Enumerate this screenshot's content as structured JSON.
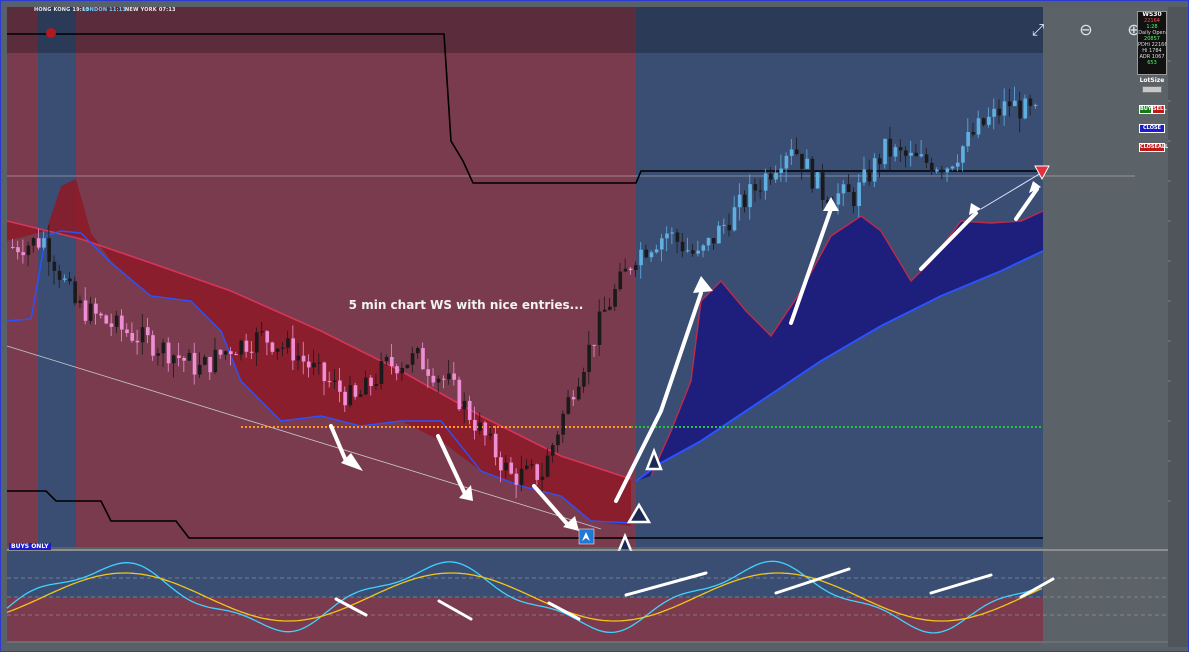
{
  "sessions": [
    {
      "label": "HONG KONG 19:13",
      "color": "#e0a020"
    },
    {
      "label": "LONDON 11:13",
      "color": "#6fc9ff"
    },
    {
      "label": "NEW YORK 07:13",
      "color": "#e8e8e8"
    }
  ],
  "toolbar": {
    "fullscreen_icon": "expand-icon",
    "zoom_out_icon": "zoom-out-icon",
    "zoom_in_icon": "zoom-in-icon"
  },
  "symbol_panel": {
    "symbol": "WS30",
    "lines": [
      "22164",
      "1:28",
      "Daily Open",
      "20857",
      "PDHi 22166",
      "Hi 1784",
      "ADR 1067",
      "653"
    ]
  },
  "trade_panel": {
    "lot_label": "LotSize",
    "buy": "BUY",
    "sell": "SELL",
    "close": "CLOSE",
    "closeall": "CLOSEALL"
  },
  "annotation": "5 min chart WS with nice entries...",
  "buys_only": "BUYS ONLY",
  "colors": {
    "bear_bg": "#7a3b4f",
    "bull_bg": "#3a4e74",
    "bull_candle": "#5fb0e0",
    "bear_candle": "#ee8fd6",
    "cloud_bear": "#8c1c28",
    "cloud_bull": "#1c1c7c",
    "gray_bg": "#5b6268"
  },
  "chart_data": {
    "type": "line",
    "title": "",
    "xlabel": "",
    "ylabel": "",
    "series": [
      {
        "values": [
          21720,
          21740,
          21560,
          21510,
          21470,
          21430,
          21380,
          21440,
          21470,
          21430,
          21350,
          21290,
          21390,
          21410,
          21340,
          21210,
          21080,
          21090,
          21330,
          21540,
          21700,
          21760,
          21690,
          21800,
          21900,
          22010,
          21870,
          21860,
          21990,
          21960,
          21950,
          22050,
          22120,
          22080
        ]
      }
    ]
  }
}
